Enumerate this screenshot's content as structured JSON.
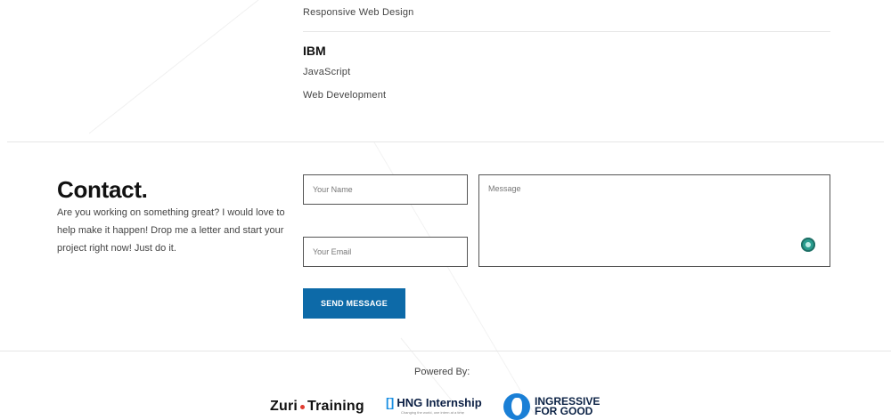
{
  "courses": {
    "top_item": "Responsive Web Design",
    "ibm": {
      "org": "IBM",
      "items": [
        "JavaScript",
        "Web Development"
      ]
    }
  },
  "contact": {
    "title": "Contact.",
    "description": "Are you working on something great? I would love to help make it happen! Drop me a letter and start your project right now! Just do it.",
    "form": {
      "name_placeholder": "Your Name",
      "email_placeholder": "Your Email",
      "message_placeholder": "Message",
      "send_label": "SEND MESSAGE"
    }
  },
  "footer": {
    "powered_by": "Powered By:",
    "logos": {
      "zuri_left": "Zuri",
      "zuri_right": "Training",
      "hng": "HNG Internship",
      "hng_tagline": "Changing the world, one intern at a time",
      "ingressive_line1": "INGRESSIVE",
      "ingressive_line2": "FOR GOOD"
    }
  },
  "colors": {
    "accent": "#0d6aa8",
    "divider": "#e6e6e6"
  }
}
